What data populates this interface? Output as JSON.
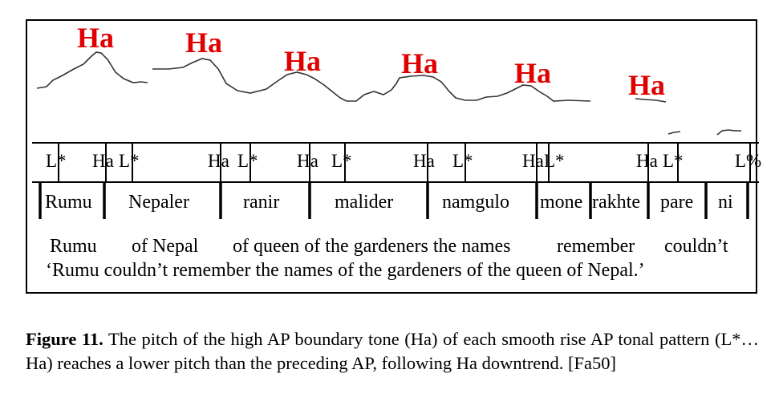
{
  "ha_label": "Ha",
  "tones": [
    "L*",
    "Ha",
    "L*",
    "Ha",
    "L*",
    "Ha",
    "L*",
    "Ha",
    "L*",
    "Ha",
    "L*",
    "Ha",
    "L*",
    "L%"
  ],
  "words": [
    "Rumu",
    "Nepaler",
    "ranir",
    "malider",
    "namgulo",
    "mone",
    "rakhte",
    "pare",
    "ni"
  ],
  "glosses": [
    "Rumu",
    "of Nepal",
    "of queen of the gardeners the names",
    "remember",
    "couldn’t"
  ],
  "translation": "‘Rumu couldn’t remember the names of the gardeners of the queen of Nepal.’",
  "caption": {
    "label": "Figure 11.",
    "text": "The pitch of the high AP boundary tone (Ha) of each smooth rise AP tonal pattern (L*…Ha) reaches a lower pitch than the preceding AP, following Ha downtrend. [Fa50]"
  },
  "colors": {
    "ha": "#e00000",
    "pitch": "#333333",
    "lines": "#000000"
  }
}
